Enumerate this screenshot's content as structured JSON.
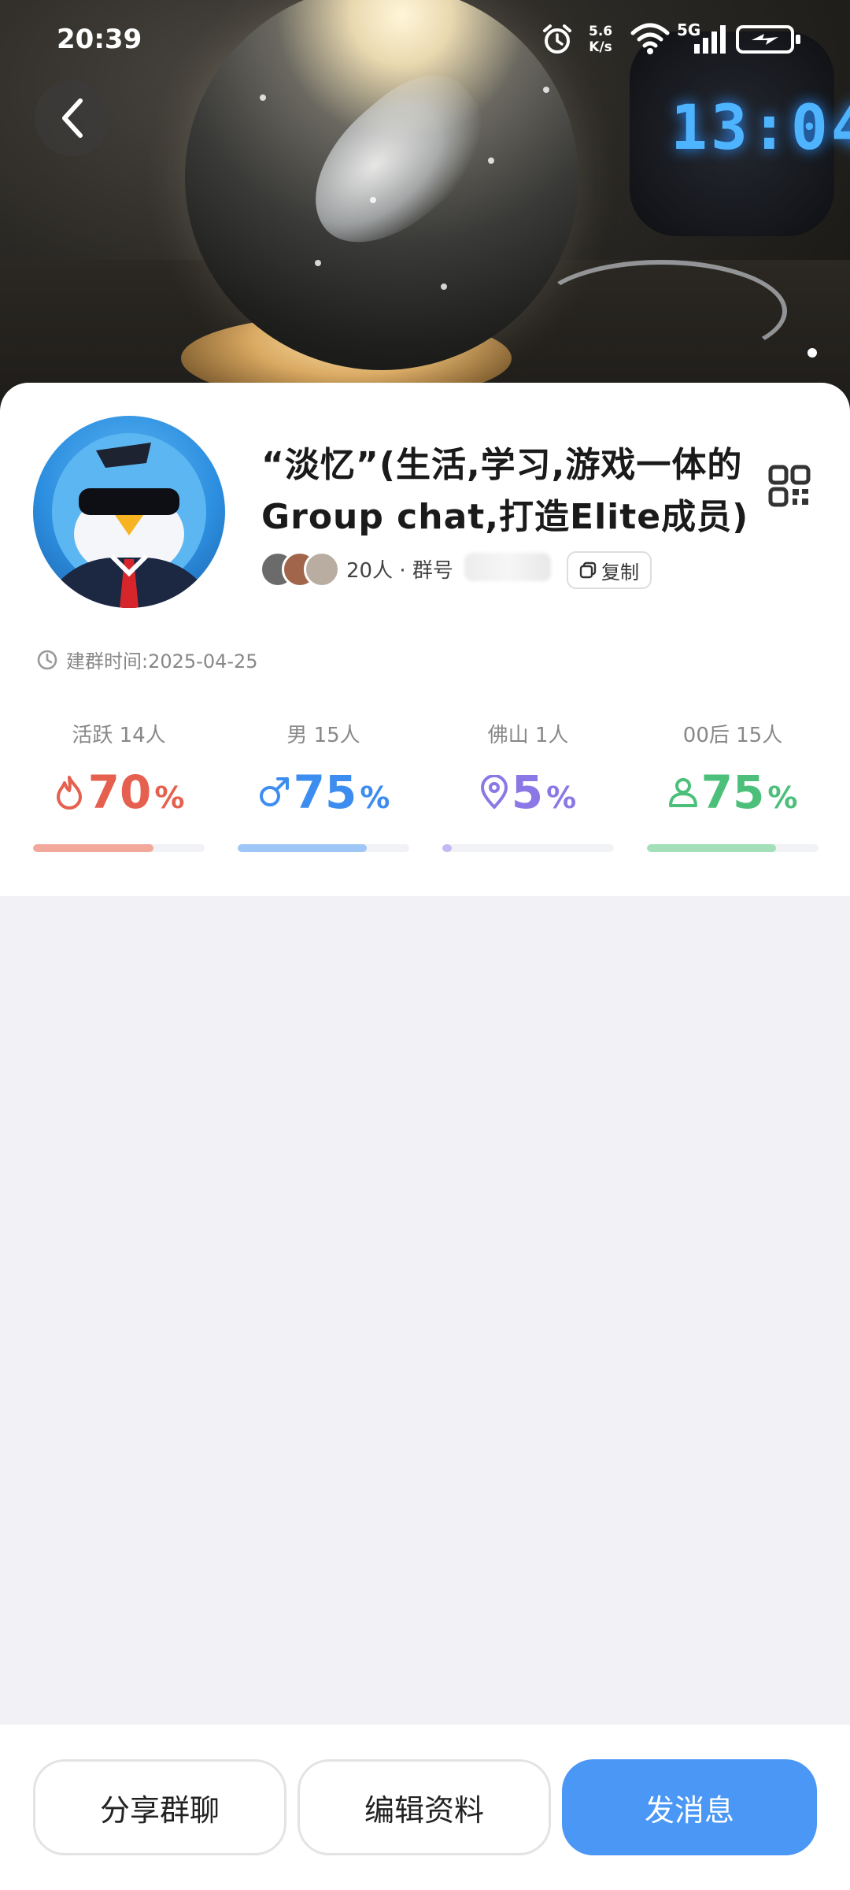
{
  "status_bar": {
    "time": "20:39",
    "net_speed_value": "5.6",
    "net_speed_unit": "K/s",
    "network": "5G",
    "icons": [
      "alarm-icon",
      "wifi-icon",
      "signal-icon",
      "battery-charging-icon"
    ]
  },
  "header": {
    "back_icon": "chevron-left-icon",
    "photo_clock_text": "13:04"
  },
  "group": {
    "title": "“淡忆”(生活,学习,游戏一体的Group chat,打造Elite成员)",
    "members_text": "20人 · 群号",
    "copy_label": "复制",
    "qr_icon": "qr-code-icon",
    "created_label": "建群时间:",
    "created_date": "2025-04-25"
  },
  "stats": [
    {
      "label": "活跃 14人",
      "value": "70",
      "unit": "%",
      "fraction": 0.7,
      "color": "#e5604e",
      "track_color": "#f2a99c",
      "icon": "flame-icon"
    },
    {
      "label": "男 15人",
      "value": "75",
      "unit": "%",
      "fraction": 0.75,
      "color": "#3d8df0",
      "track_color": "#9ec6f7",
      "icon": "male-icon"
    },
    {
      "label": "佛山 1人",
      "value": "5",
      "unit": "%",
      "fraction": 0.05,
      "color": "#8b78e6",
      "track_color": "#c4b9f3",
      "icon": "location-pin-icon"
    },
    {
      "label": "00后 15人",
      "value": "75",
      "unit": "%",
      "fraction": 0.75,
      "color": "#4cc07a",
      "track_color": "#a3dfb9",
      "icon": "person-icon"
    }
  ],
  "actions": {
    "share": "分享群聊",
    "edit": "编辑资料",
    "send": "发消息"
  },
  "colors": {
    "primary": "#4a97f5",
    "background": "#f2f2f6"
  }
}
